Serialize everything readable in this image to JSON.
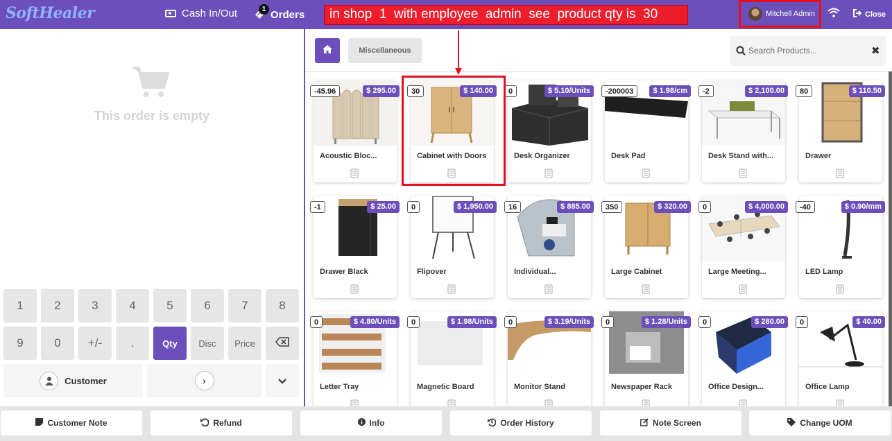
{
  "app": {
    "logo": "SoftHealer"
  },
  "header": {
    "cash_label": "Cash In/Out",
    "orders_label": "Orders",
    "orders_count": "1",
    "annotation": "in shop  1  with employee  admin  see  product qty is  30",
    "user_name": "Mitchell Admin",
    "close_label": "Close"
  },
  "order": {
    "empty_text": "This order is empty"
  },
  "numpad": {
    "row1": [
      "1",
      "2",
      "3",
      "4",
      "5",
      "6",
      "7",
      "8"
    ],
    "row2": [
      "9",
      "0",
      "+/-",
      ".",
      "Qty",
      "Disc",
      "Price"
    ],
    "customer_label": "Customer"
  },
  "category": {
    "label": "Miscellaneous"
  },
  "search": {
    "placeholder": "Search Products..."
  },
  "products": [
    {
      "name": "Acoustic Bloc...",
      "qty": "-45.96",
      "price": "$ 295.00"
    },
    {
      "name": "Cabinet with Doors",
      "qty": "30",
      "price": "$ 140.00"
    },
    {
      "name": "Desk Organizer",
      "qty": "0",
      "price": "$ 5.10/Units"
    },
    {
      "name": "Desk Pad",
      "qty": "-200003",
      "price": "$ 1.98/cm"
    },
    {
      "name": "Desk Stand with...",
      "qty": "-2",
      "price": "$ 2,100.00"
    },
    {
      "name": "Drawer",
      "qty": "80",
      "price": "$ 110.50"
    },
    {
      "name": "Drawer Black",
      "qty": "-1",
      "price": "$ 25.00"
    },
    {
      "name": "Flipover",
      "qty": "0",
      "price": "$ 1,950.00"
    },
    {
      "name": "Individual...",
      "qty": "16",
      "price": "$ 885.00"
    },
    {
      "name": "Large Cabinet",
      "qty": "350",
      "price": "$ 320.00"
    },
    {
      "name": "Large Meeting...",
      "qty": "0",
      "price": "$ 4,000.00"
    },
    {
      "name": "LED Lamp",
      "qty": "-40",
      "price": "$ 0.90/mm"
    },
    {
      "name": "Letter Tray",
      "qty": "0",
      "price": "$ 4.80/Units"
    },
    {
      "name": "Magnetic Board",
      "qty": "0",
      "price": "$ 1.98/Units"
    },
    {
      "name": "Monitor Stand",
      "qty": "0",
      "price": "$ 3.19/Units"
    },
    {
      "name": "Newspaper Rack",
      "qty": "0",
      "price": "$ 1.28/Units"
    },
    {
      "name": "Office Design...",
      "qty": "0",
      "price": "$ 280.00"
    },
    {
      "name": "Office Lamp",
      "qty": "0",
      "price": "$ 40.00"
    }
  ],
  "footer": {
    "customer_note": "Customer Note",
    "refund": "Refund",
    "info": "Info",
    "order_history": "Order History",
    "note_screen": "Note Screen",
    "change_uom": "Change UOM"
  },
  "colors": {
    "accent": "#6c4fbb",
    "highlight": "#e0101c"
  }
}
